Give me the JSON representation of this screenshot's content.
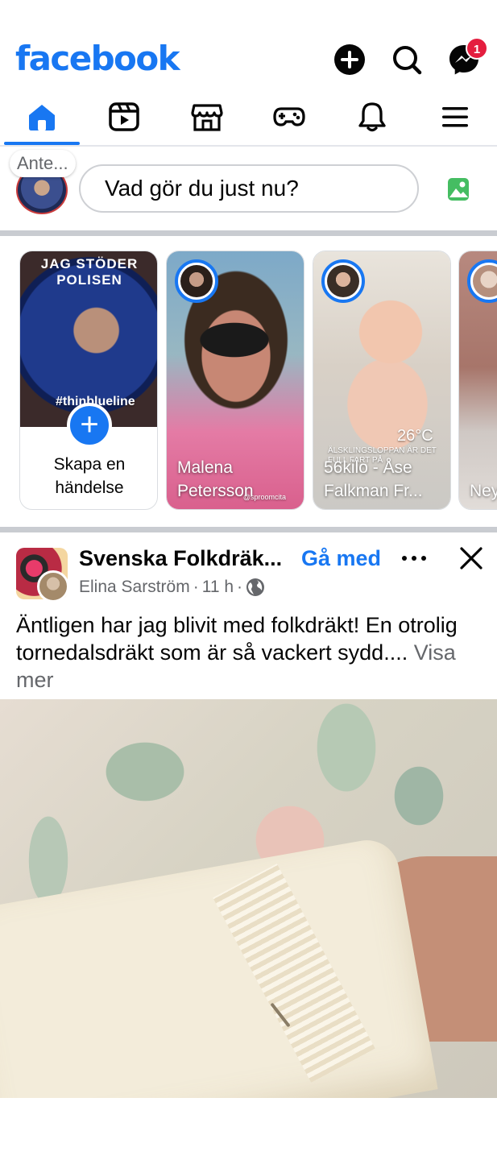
{
  "header": {
    "logo": "facebook",
    "messenger_badge": "1",
    "icons": [
      "add-icon",
      "search-icon",
      "messenger-icon"
    ]
  },
  "tabs": [
    {
      "name": "home",
      "active": true
    },
    {
      "name": "reels"
    },
    {
      "name": "marketplace"
    },
    {
      "name": "gaming"
    },
    {
      "name": "notifications"
    },
    {
      "name": "menu"
    }
  ],
  "composer": {
    "avatar_label": "Ante...",
    "placeholder": "Vad gör du just nu?"
  },
  "stories": {
    "create": {
      "ring_text": "JAG STÖDER POLISEN",
      "ring_text_bottom": "#thinblueline",
      "label": "Skapa en händelse"
    },
    "items": [
      {
        "name": "Malena Petersson",
        "overlay": "@sproomcita"
      },
      {
        "name": "56kilo - Åse Falkman Fr...",
        "overlay_temp": "26°C",
        "overlay_text": "ÄLSKLINGSLOPPAN ÄR DET FULL FART PÅ"
      },
      {
        "name": "Ney Mic"
      }
    ]
  },
  "post": {
    "group": "Svenska Folkdräk...",
    "join": "Gå med",
    "author": "Elina Sarström",
    "time": "11 h",
    "text": "Äntligen har jag blivit med folkdräkt! En otrolig tornedalsdräkt som är så vackert sydd....",
    "see_more": "Visa mer"
  },
  "colors": {
    "brand": "#1877f2",
    "badge": "#e41e3f",
    "secondary_text": "#65676b"
  }
}
